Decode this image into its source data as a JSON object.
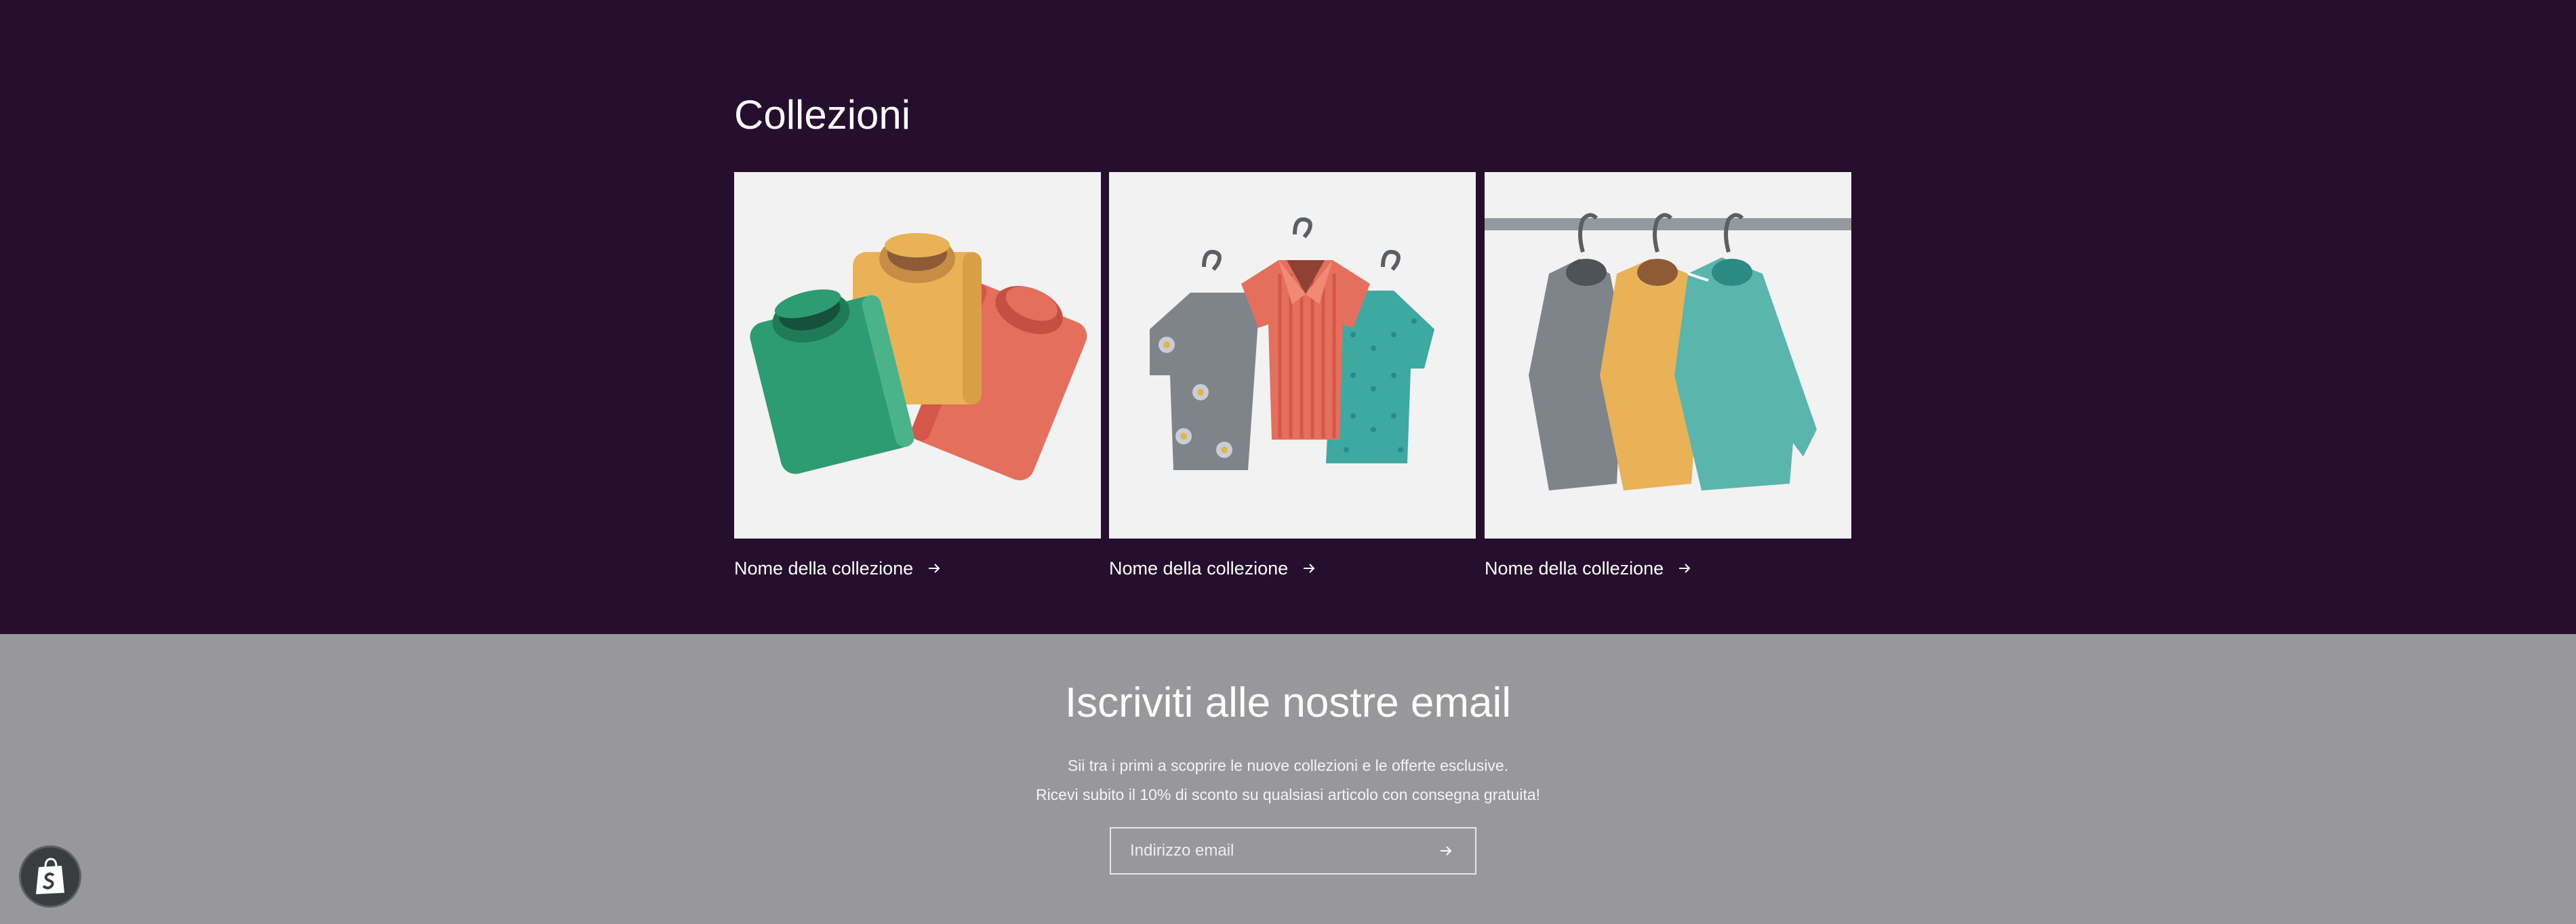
{
  "collections": {
    "title": "Collezioni",
    "items": [
      {
        "label": "Nome della collezione",
        "image_icon": "folded-tshirts-icon"
      },
      {
        "label": "Nome della collezione",
        "image_icon": "hanging-shirts-icon"
      },
      {
        "label": "Nome della collezione",
        "image_icon": "clothes-rack-sweaters-icon"
      }
    ]
  },
  "newsletter": {
    "title": "Iscriviti alle nostre email",
    "line1": "Sii tra i primi a scoprire le nuove collezioni e le offerte esclusive.",
    "line2": "Ricevi subito il 10% di sconto su qualsiasi articolo con consegna gratuita!",
    "email_placeholder": "Indirizzo email",
    "submit_icon": "arrow-right-icon"
  },
  "shop_badge_icon": "shopify-bag-icon",
  "colors": {
    "collections_bg": "#250e2e",
    "newsletter_bg": "#98989a",
    "card_bg": "#f2f2f2"
  }
}
